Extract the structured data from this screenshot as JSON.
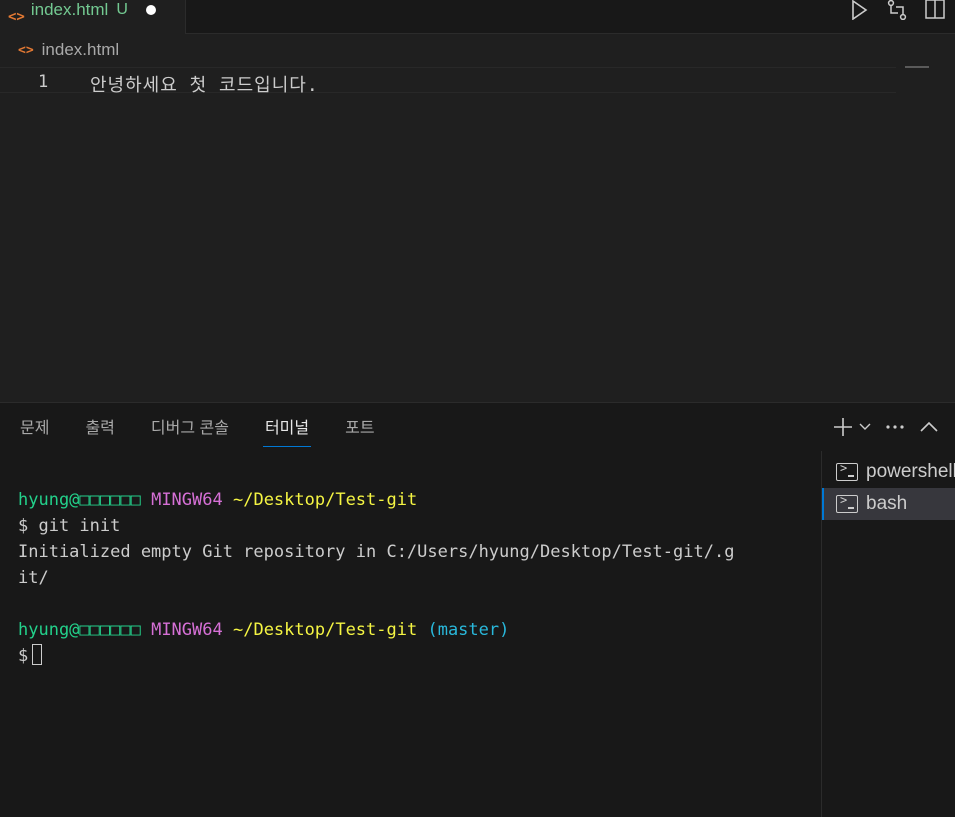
{
  "tab": {
    "icon": "html-file-icon",
    "name": "index.html",
    "status": "U"
  },
  "editor_actions": [
    "run-icon",
    "compare-icon",
    "split-editor-icon"
  ],
  "breadcrumb": {
    "icon": "html-file-icon",
    "file": "index.html"
  },
  "editor": {
    "lines": [
      {
        "number": "1",
        "text": "안녕하세요 첫 코드입니다."
      }
    ]
  },
  "panel": {
    "tabs": [
      "문제",
      "출력",
      "디버그 콘솔",
      "터미널",
      "포트"
    ],
    "active_tab": "터미널",
    "actions": [
      "plus-icon",
      "chevron-down-icon",
      "more-icon",
      "chevron-up-icon"
    ]
  },
  "terminal": {
    "prompt1": {
      "user": "hyung@□□□□□□",
      "host": "MINGW64",
      "path": "~/Desktop/Test-git"
    },
    "cmd1": "$ git init",
    "output1": "Initialized empty Git repository in C:/Users/hyung/Desktop/Test-git/.g",
    "output2": "it/",
    "prompt2": {
      "user": "hyung@□□□□□□",
      "host": "MINGW64",
      "path": "~/Desktop/Test-git",
      "branch": "(master)"
    },
    "cmd2": "$"
  },
  "terminal_list": [
    {
      "name": "powershell",
      "active": false
    },
    {
      "name": "bash",
      "active": true
    }
  ],
  "colors": {
    "background": "#1f1f1f",
    "accent": "#0078d4",
    "untracked": "#73c991",
    "html_icon": "#e37933"
  }
}
